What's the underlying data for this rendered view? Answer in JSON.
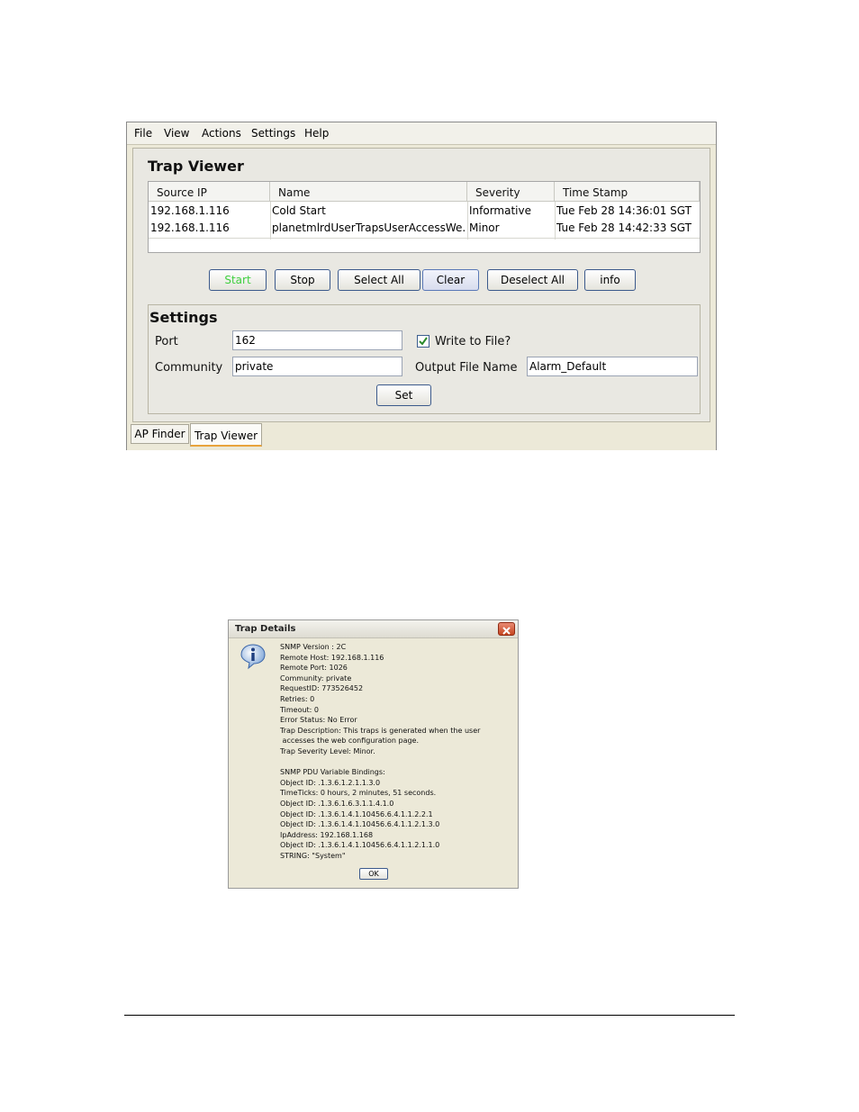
{
  "menubar": {
    "items": [
      "File",
      "View",
      "Actions",
      "Settings",
      "Help"
    ]
  },
  "panel": {
    "title": "Trap Viewer"
  },
  "table": {
    "columns": [
      "Source IP",
      "Name",
      "Severity",
      "Time Stamp"
    ],
    "rows": [
      [
        "192.168.1.116",
        "Cold Start",
        "Informative",
        "Tue Feb 28 14:36:01 SGT"
      ],
      [
        "192.168.1.116",
        "planetmlrdUserTrapsUserAccessWe...",
        "Minor",
        "Tue Feb 28 14:42:33 SGT"
      ]
    ]
  },
  "buttons": {
    "start": "Start",
    "stop": "Stop",
    "select_all": "Select All",
    "clear": "Clear",
    "deselect_all": "Deselect All",
    "info": "info"
  },
  "settings": {
    "title": "Settings",
    "port_label": "Port",
    "port_value": "162",
    "community_label": "Community",
    "community_value": "private",
    "write_file_label": "Write to File?",
    "write_file_checked": true,
    "output_file_label": "Output File Name",
    "output_file_value": "Alarm_Default",
    "set_button": "Set"
  },
  "tabs": [
    "AP Finder",
    "Trap Viewer"
  ],
  "dialog": {
    "title": "Trap Details",
    "lines": [
      "SNMP Version : 2C",
      "Remote Host: 192.168.1.116",
      "Remote Port: 1026",
      "Community: private",
      "RequestID: 773526452",
      "Retries: 0",
      "Timeout: 0",
      "Error Status: No Error",
      "Trap Description: This traps is generated when the user",
      " accesses the web configuration page.",
      "Trap Severity Level: Minor.",
      "",
      "SNMP PDU Variable Bindings:",
      "Object ID: .1.3.6.1.2.1.1.3.0",
      "TimeTicks: 0 hours, 2 minutes, 51 seconds.",
      "Object ID: .1.3.6.1.6.3.1.1.4.1.0",
      "Object ID: .1.3.6.1.4.1.10456.6.4.1.1.2.2.1",
      "Object ID: .1.3.6.1.4.1.10456.6.4.1.1.2.1.3.0",
      "IpAddress: 192.168.1.168",
      "Object ID: .1.3.6.1.4.1.10456.6.4.1.1.2.1.1.0",
      "STRING: \"System\""
    ],
    "ok_button": "OK"
  }
}
